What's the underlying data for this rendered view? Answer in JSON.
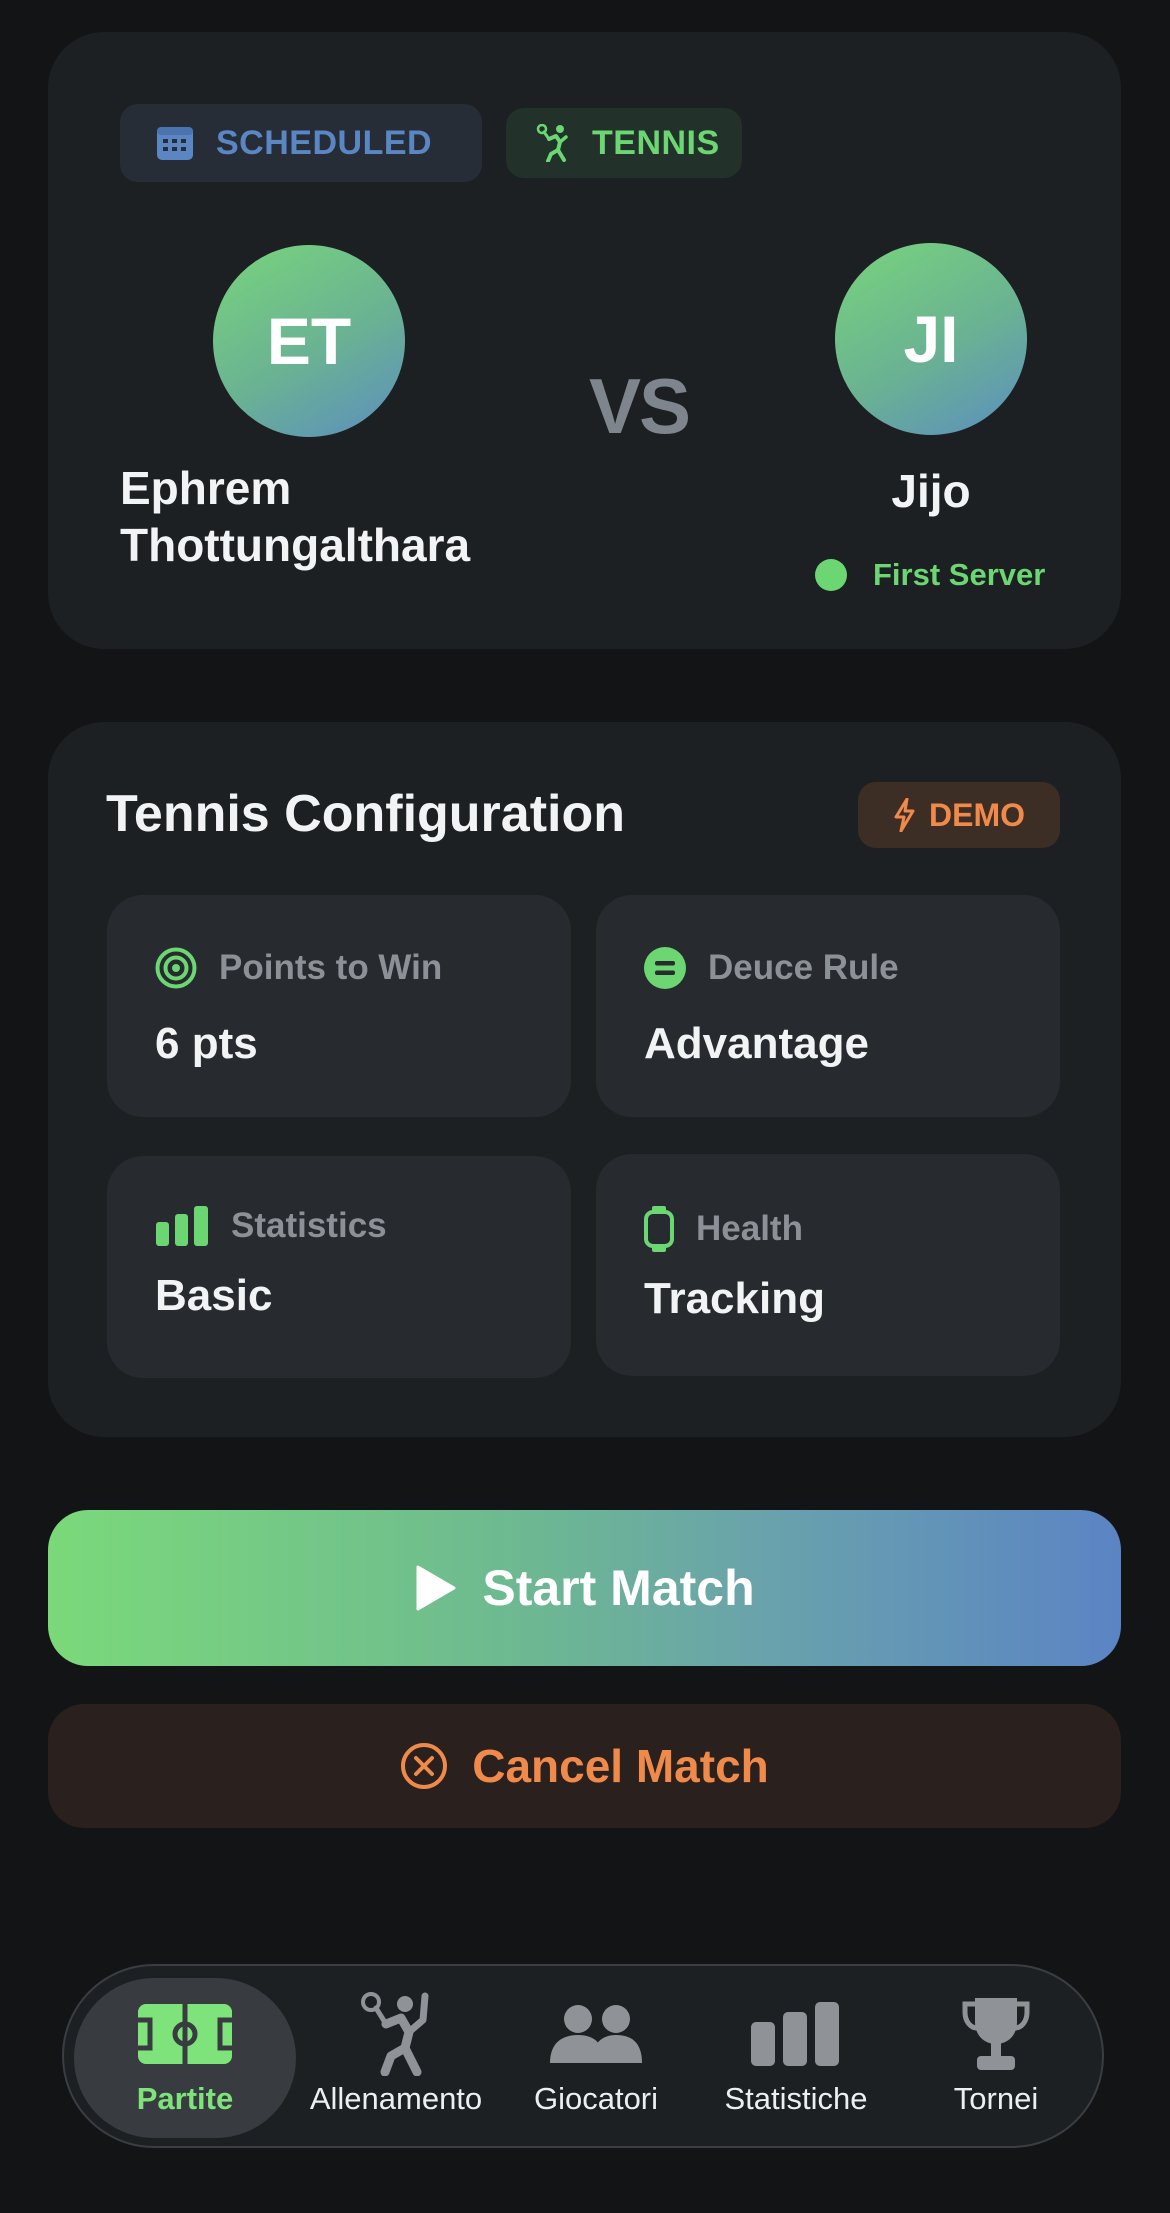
{
  "match": {
    "status": "SCHEDULED",
    "status_icon": "calendar-icon",
    "sport": "TENNIS",
    "sport_icon": "tennis-player-icon",
    "player_left": {
      "initials": "ET",
      "name": "Ephrem Thottungalthara"
    },
    "vs": "VS",
    "player_right": {
      "initials": "JI",
      "name": "Jijo",
      "server_label": "First Server"
    }
  },
  "config": {
    "title": "Tennis Configuration",
    "demo_label": "DEMO",
    "tiles": [
      {
        "icon": "target-icon",
        "label": "Points to Win",
        "value": "6 pts"
      },
      {
        "icon": "equals-icon",
        "label": "Deuce Rule",
        "value": "Advantage"
      },
      {
        "icon": "bar-chart-icon",
        "label": "Statistics",
        "value": "Basic"
      },
      {
        "icon": "watch-icon",
        "label": "Health",
        "value": "Tracking"
      }
    ]
  },
  "actions": {
    "start_label": "Start Match",
    "cancel_label": "Cancel Match"
  },
  "nav": {
    "items": [
      {
        "label": "Partite",
        "icon": "soccer-field-icon",
        "active": true
      },
      {
        "label": "Allenamento",
        "icon": "tennis-player-icon",
        "active": false
      },
      {
        "label": "Giocatori",
        "icon": "people-icon",
        "active": false
      },
      {
        "label": "Statistiche",
        "icon": "bar-chart-icon",
        "active": false
      },
      {
        "label": "Tornei",
        "icon": "trophy-icon",
        "active": false
      }
    ]
  },
  "colors": {
    "accent_green": "#6bd672",
    "accent_blue": "#5b86c4",
    "accent_orange": "#f08a4b",
    "background": "#121416",
    "card": "#1d2023"
  }
}
